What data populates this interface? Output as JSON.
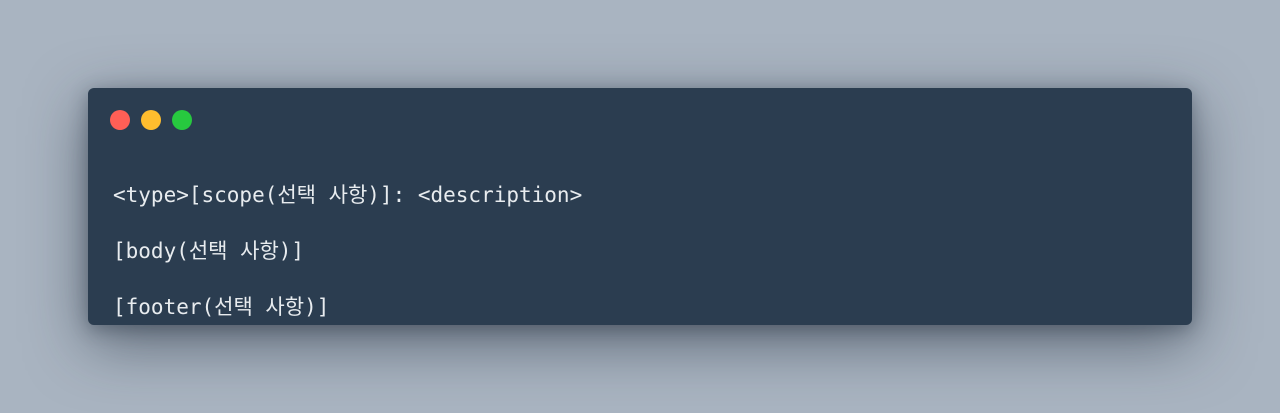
{
  "window": {
    "controls": [
      {
        "name": "close-button",
        "icon": "close-dot",
        "color": "#ff5f56"
      },
      {
        "name": "minimize-button",
        "icon": "minimize-dot",
        "color": "#ffbd2e"
      },
      {
        "name": "zoom-button",
        "icon": "zoom-dot",
        "color": "#27c93f"
      }
    ]
  },
  "code": {
    "lines": [
      "<type>[scope(선택 사항)]: <description>",
      "[body(선택 사항)]",
      "[footer(선택 사항)]"
    ]
  }
}
